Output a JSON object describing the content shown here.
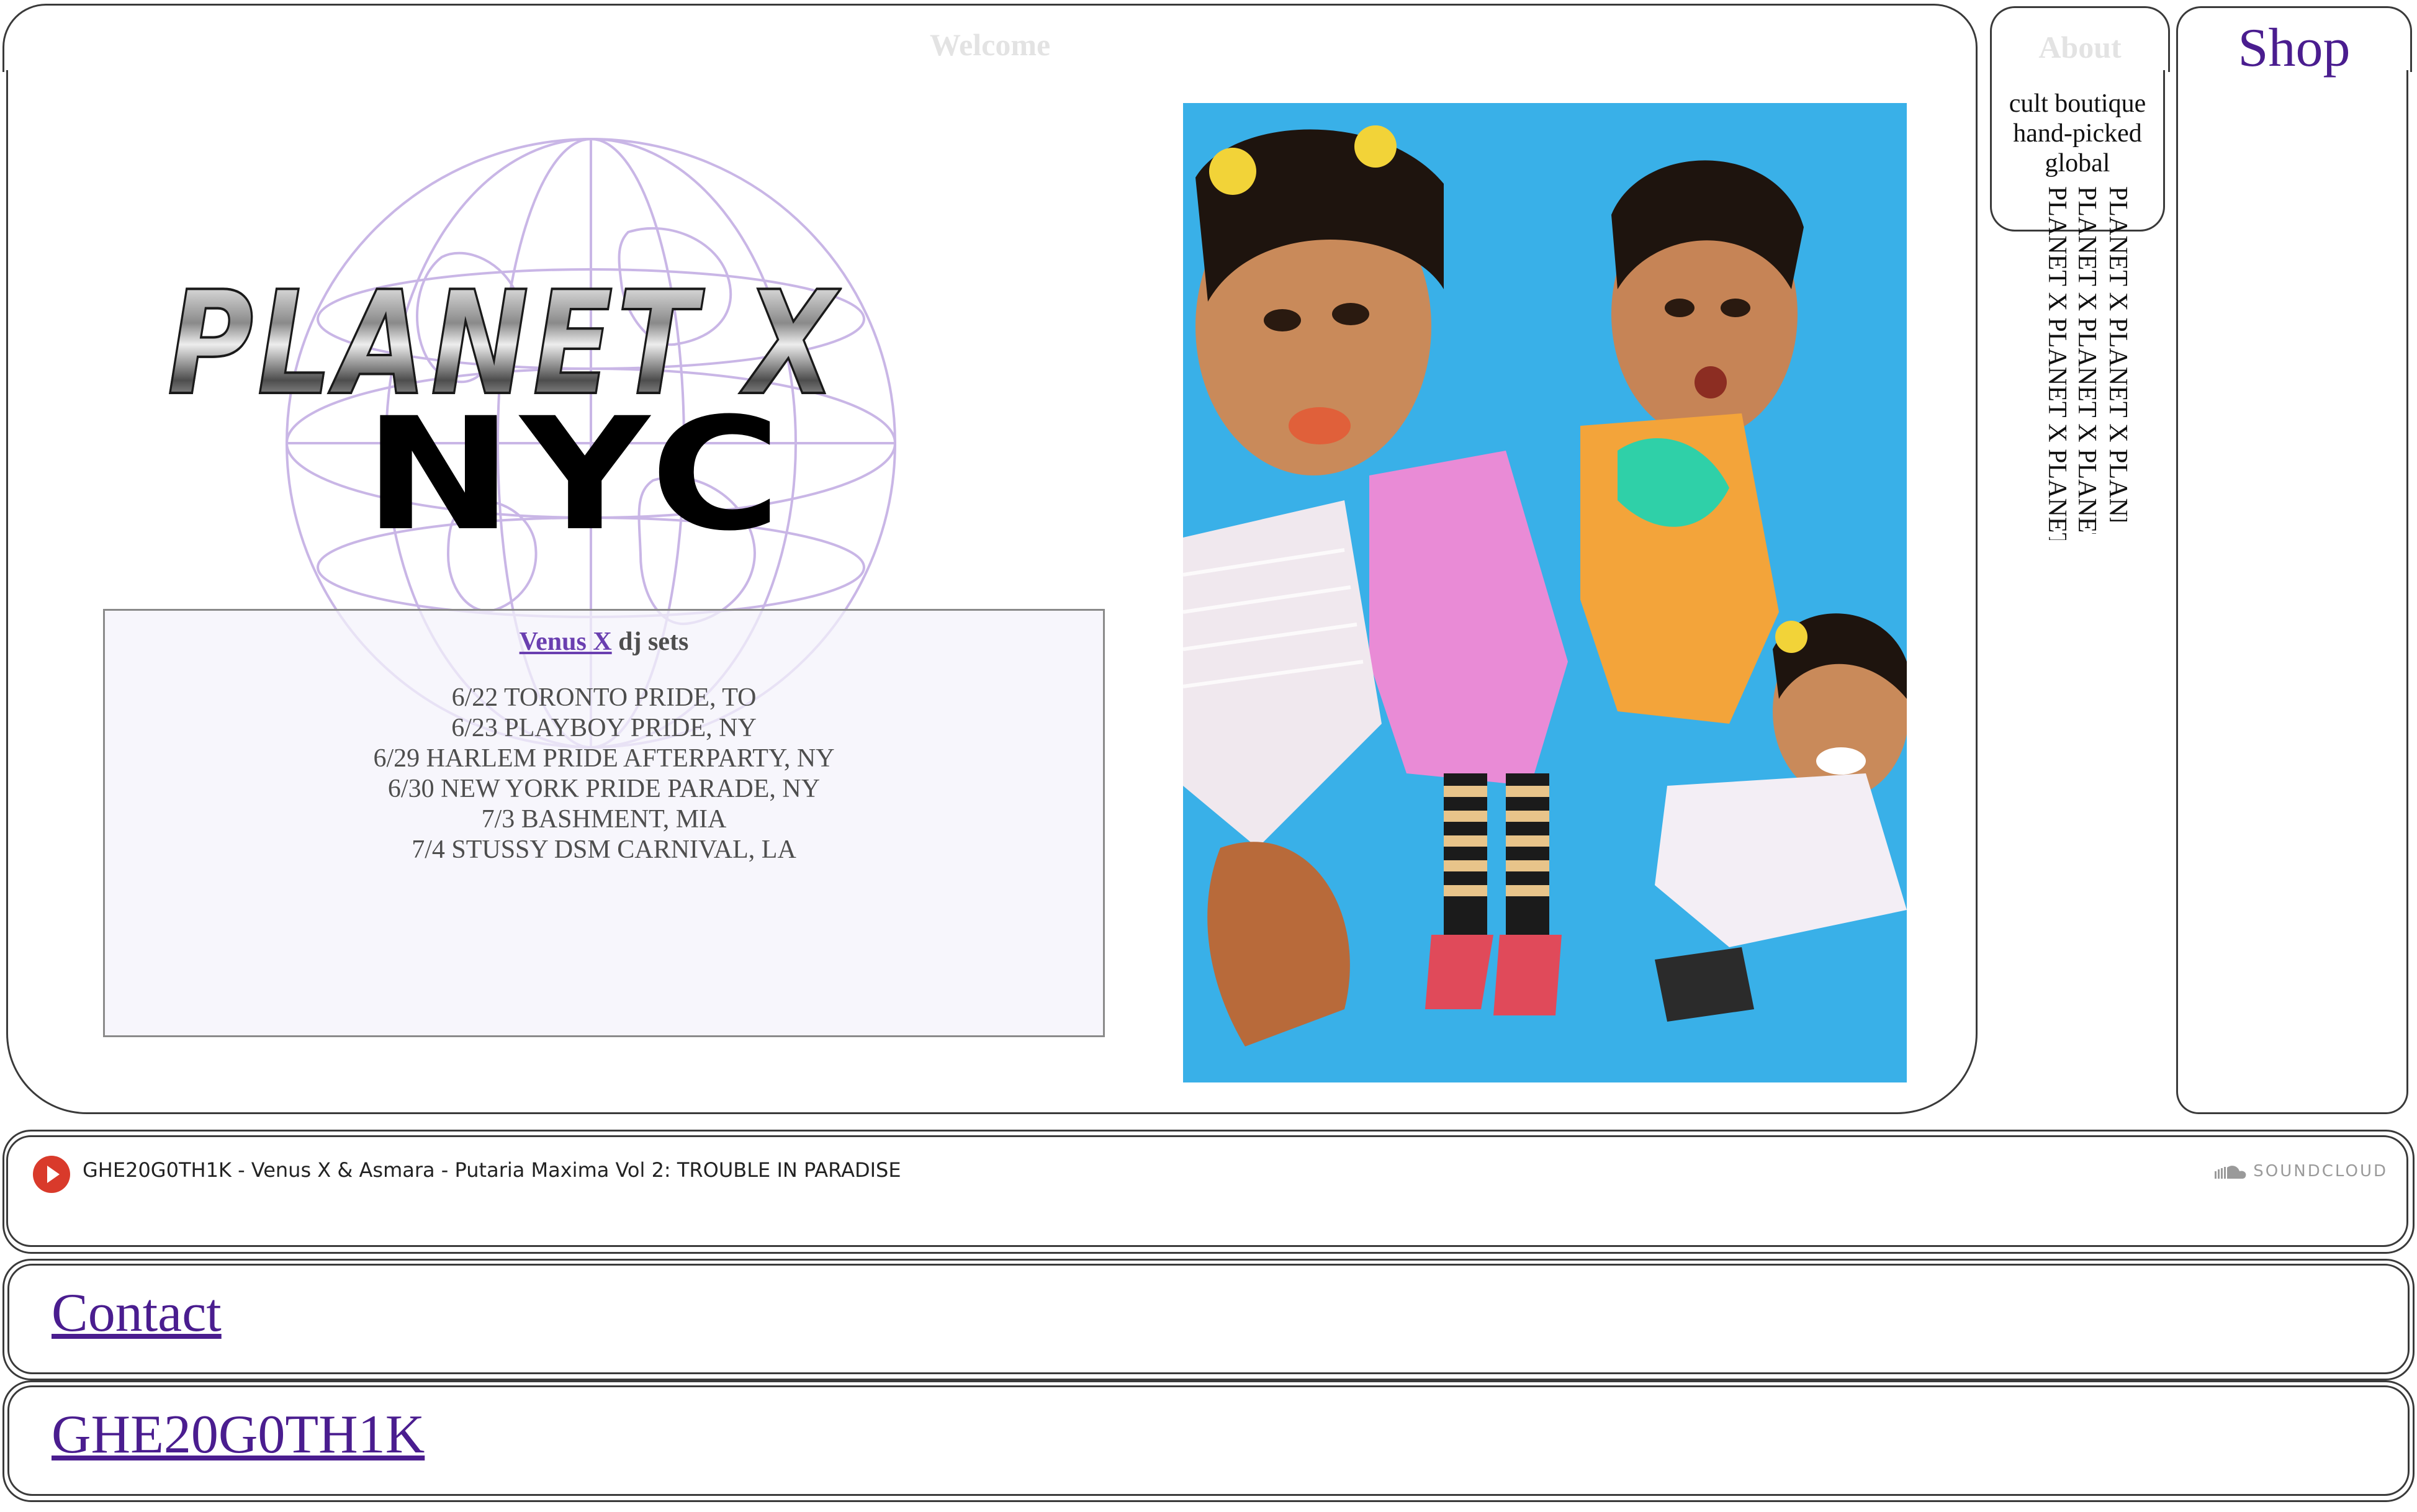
{
  "tabs": {
    "welcome": "Welcome",
    "about": "About",
    "shop": "Shop"
  },
  "about_menu": {
    "lines": [
      "cult boutique",
      "hand-picked",
      "global"
    ],
    "scroll_text": "PLANET X PLANET X PLANET X PLANET X PLANET X PLANET X"
  },
  "logo": {
    "line1": "PLANET X",
    "line2": "NYC"
  },
  "dj_sets": {
    "artist_link": "Venus X",
    "heading_suffix": " dj sets",
    "dates": [
      "6/22 TORONTO PRIDE, TO",
      "6/23 PLAYBOY PRIDE, NY",
      "6/29 HARLEM PRIDE AFTERPARTY, NY",
      "6/30 NEW YORK PRIDE PARADE, NY",
      "7/3 BASHMENT, MIA",
      "7/4 STUSSY DSM CARNIVAL, LA"
    ]
  },
  "player": {
    "track": "GHE20G0TH1K - Venus X & Asmara - Putaria Maxima Vol 2: TROUBLE IN PARADISE",
    "brand": "SOUNDCLOUD",
    "play_icon": "play-icon"
  },
  "links": {
    "contact": "Contact",
    "ghe20g0th1k": "GHE20G0TH1K"
  },
  "colors": {
    "link": "#4a1d8f",
    "border": "#3a3a3a",
    "play": "#d93a2b",
    "photo_bg": "#35a9e6"
  }
}
